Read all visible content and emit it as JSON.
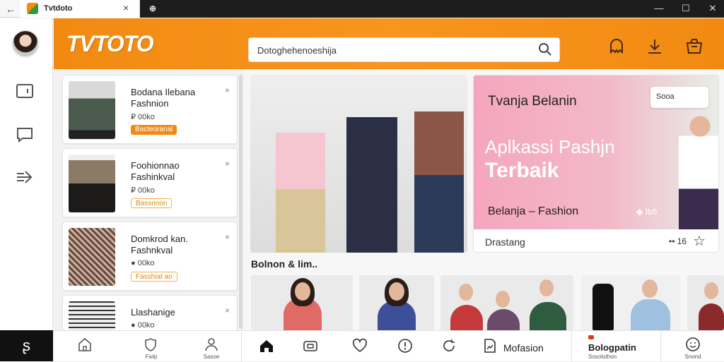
{
  "browser": {
    "tab_title": "Tvtdoto",
    "back_glyph": "←",
    "close_glyph": "×",
    "minimize_glyph": "—",
    "maximize_glyph": "☐",
    "window_close_glyph": "✕"
  },
  "app": {
    "logo": "TVTOTO",
    "accent_color": "#f28a12",
    "search": {
      "value": "Dotoghehenoeshija"
    },
    "header_icons": [
      "chat-bubble-icon",
      "download-icon",
      "basket-icon"
    ]
  },
  "left_rail": {
    "icons": [
      "tablet-icon",
      "message-icon",
      "share-arrow-icon"
    ],
    "brand_glyph": "ʂ"
  },
  "product_list": [
    {
      "name": "Bodana Ilebana Fashnion",
      "price": "₽ 00ko",
      "tag": "Bacteoranal",
      "tag_style": "filled",
      "close": "×"
    },
    {
      "name": "Foohionnao Fashinkval",
      "price": "₽ 00ko",
      "tag": "Bassrinon",
      "tag_style": "outline",
      "close": "×"
    },
    {
      "name": "Domkrod kan. Fashnkval",
      "price": "● 00ko",
      "tag": "Fasshiat ao",
      "tag_style": "outline",
      "close": "×"
    },
    {
      "name": "Llashanige",
      "price": "● 00ko",
      "tag": "",
      "tag_style": "none",
      "close": "×"
    }
  ],
  "banner": {
    "title": "Tvanja Belanin",
    "pill_text": "Sooa",
    "headline_line1": "Aplkassi Pashjn",
    "headline_line2": "Terbaik",
    "subline": "Belanja – Fashion",
    "count": "◆ Ib6",
    "footer_label": "Drastang",
    "footer_count": "•• 16",
    "star_glyph": "☆"
  },
  "section": {
    "title": "Bolnon & lim.."
  },
  "bottom_nav": {
    "left_items": [
      {
        "icon": "home-outline-icon",
        "label": ""
      },
      {
        "icon": "shield-icon",
        "label": "Fwlp"
      },
      {
        "icon": "person-icon",
        "label": "Sasoe"
      }
    ],
    "center_items": [
      "home-icon",
      "camera-icon",
      "heart-icon",
      "alert-icon",
      "refresh-icon"
    ],
    "wide_item": {
      "icon": "document-icon",
      "label": "Mofasion"
    },
    "right_item": {
      "label": "Bologpatin",
      "sub": "Sosoluthon"
    },
    "last_item": {
      "icon": "smile-icon",
      "label": "Snond"
    }
  }
}
